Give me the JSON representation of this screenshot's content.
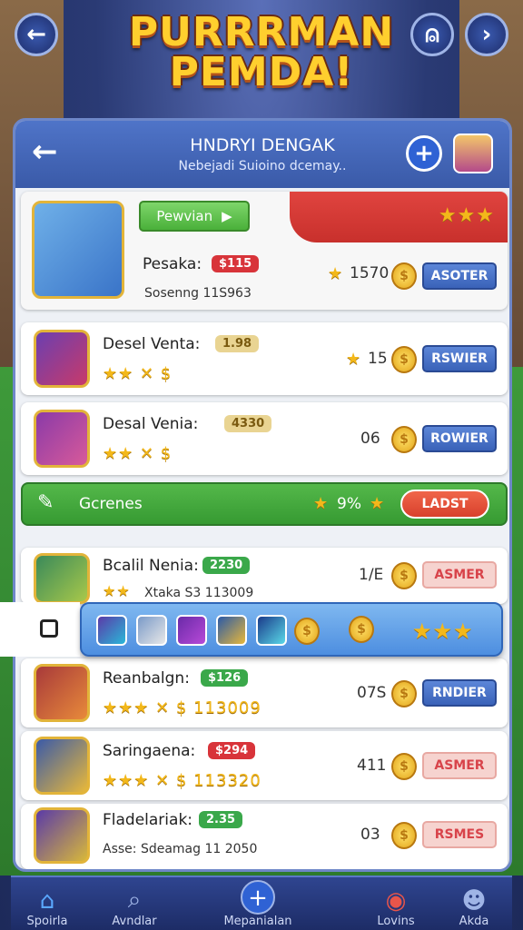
{
  "header": {
    "title_line1": "PURRRMAN",
    "title_line2": "PEMDA!",
    "back_icon": "←",
    "person_icon": "⍝",
    "forward_icon": "›"
  },
  "panel": {
    "back_icon": "←",
    "title": "HNDRYI DENGAK",
    "subtitle": "Nebejadi Suioino dcemay..",
    "plus_icon": "+"
  },
  "featured": {
    "button": "Pewvian",
    "button_icon": "▶",
    "stars": "★★★",
    "name": "Pesaka:",
    "tag": "$115",
    "sub": "Sosenng 11S963",
    "value": "1570",
    "action": "ASOTER"
  },
  "rows": [
    {
      "name": "Desel Venta:",
      "tag": "1.98",
      "stars": "★★ ✕ $",
      "value": "15",
      "action": "RSWIER"
    },
    {
      "name": "Desal Venia:",
      "tag": "4330",
      "stars": "★★ ✕ $",
      "value": "06",
      "action": "ROWIER"
    }
  ],
  "banner": {
    "label": "Gcrenes",
    "stat": "9%",
    "button": "LADST"
  },
  "row4": {
    "name": "Bcalil Nenia:",
    "tag": "2230",
    "stars": "★★",
    "sub": "Xtaka S3 113009",
    "value": "1/E",
    "action": "ASMER"
  },
  "floatbar": {
    "stars": "★★★",
    "coin": "$"
  },
  "rows_bottom": [
    {
      "name": "Reanbalgn:",
      "tag": "$126",
      "stars": "★★★ ✕ $ 113009",
      "value": "07S",
      "action": "RNDIER"
    },
    {
      "name": "Saringaena:",
      "tag": "$294",
      "stars": "★★★ ✕ $ 113320",
      "value": "411",
      "action": "ASMER"
    },
    {
      "name": "Fladelariak:",
      "tag": "2.35",
      "sub": "Asse: Sdeamag 11 2050",
      "value": "03",
      "action": "RSMES"
    }
  ],
  "tabs": [
    {
      "label": "Spoirla",
      "icon": "⌂"
    },
    {
      "label": "Avndlar",
      "icon": "⌕"
    },
    {
      "label": "Mepanialan",
      "icon": "+"
    },
    {
      "label": "Lovins",
      "icon": "◉"
    },
    {
      "label": "Akda",
      "icon": "☻"
    }
  ]
}
